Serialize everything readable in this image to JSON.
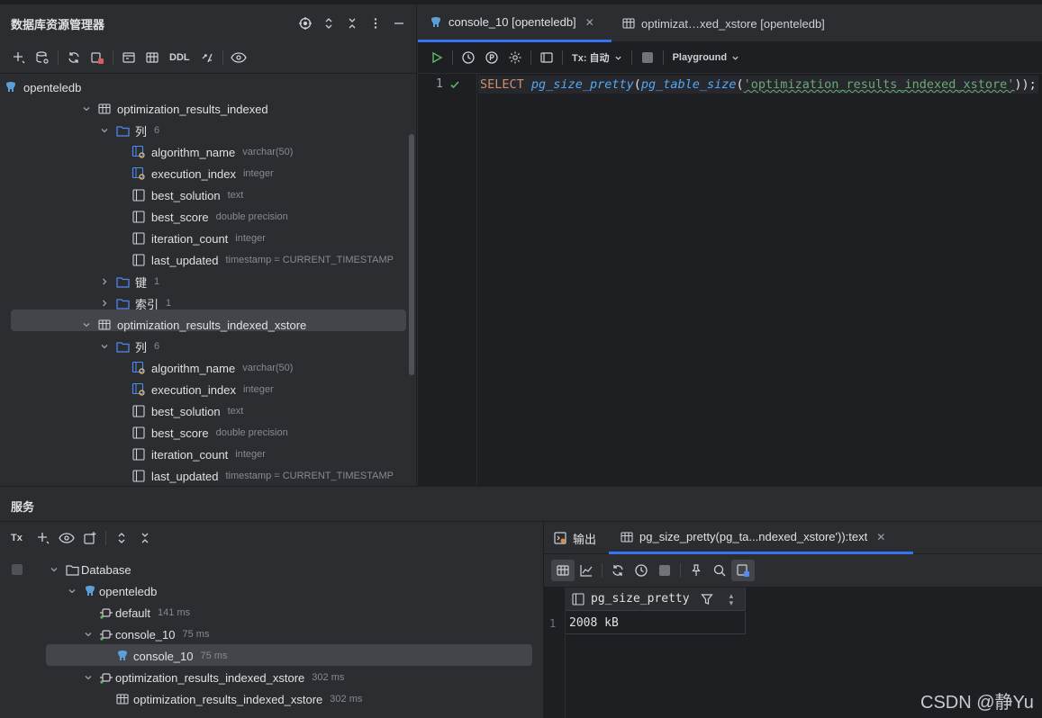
{
  "left_panel": {
    "title": "数据库资源管理器",
    "toolbar_ddl": "DDL",
    "tree": [
      {
        "label": "openteledb",
        "meta": ""
      },
      {
        "label": "optimization_results_indexed",
        "meta": ""
      },
      {
        "label": "列",
        "meta": "6"
      },
      {
        "label": "algorithm_name",
        "meta": "varchar(50)"
      },
      {
        "label": "execution_index",
        "meta": "integer"
      },
      {
        "label": "best_solution",
        "meta": "text"
      },
      {
        "label": "best_score",
        "meta": "double precision"
      },
      {
        "label": "iteration_count",
        "meta": "integer"
      },
      {
        "label": "last_updated",
        "meta": "timestamp = CURRENT_TIMESTAMP"
      },
      {
        "label": "键",
        "meta": "1"
      },
      {
        "label": "索引",
        "meta": "1"
      },
      {
        "label": "optimization_results_indexed_xstore",
        "meta": ""
      },
      {
        "label": "列",
        "meta": "6"
      },
      {
        "label": "algorithm_name",
        "meta": "varchar(50)"
      },
      {
        "label": "execution_index",
        "meta": "integer"
      },
      {
        "label": "best_solution",
        "meta": "text"
      },
      {
        "label": "best_score",
        "meta": "double precision"
      },
      {
        "label": "iteration_count",
        "meta": "integer"
      },
      {
        "label": "last_updated",
        "meta": "timestamp = CURRENT_TIMESTAMP"
      }
    ]
  },
  "editor": {
    "tabs": [
      {
        "label": "console_10 [openteledb]",
        "active": true
      },
      {
        "label": "optimizat…xed_xstore [openteledb]",
        "active": false
      }
    ],
    "tx_label": "Tx: 自动",
    "playground_label": "Playground",
    "line_number": "1",
    "code": {
      "kw": "SELECT",
      "fn1": "pg_size_pretty",
      "p1": "(",
      "fn2": "pg_table_size",
      "p2": "(",
      "str": "'optimization_results_indexed_xstore'",
      "tail": "));"
    }
  },
  "services": {
    "title": "服务",
    "tx_label": "Tx",
    "tree": [
      {
        "label": "Database",
        "meta": ""
      },
      {
        "label": "openteledb",
        "meta": ""
      },
      {
        "label": "default",
        "meta": "141 ms"
      },
      {
        "label": "console_10",
        "meta": "75 ms"
      },
      {
        "label": "console_10",
        "meta": "75 ms"
      },
      {
        "label": "optimization_results_indexed_xstore",
        "meta": "302 ms"
      },
      {
        "label": "optimization_results_indexed_xstore",
        "meta": "302 ms"
      }
    ]
  },
  "results": {
    "tabs": [
      {
        "label": "输出"
      },
      {
        "label": "pg_size_pretty(pg_ta...ndexed_xstore')):text"
      }
    ],
    "column_header": "pg_size_pretty",
    "rows": [
      {
        "num": "1",
        "value": "2008 kB"
      }
    ]
  },
  "watermark": "CSDN @静Yu",
  "colors": {
    "bg": "#2b2d30",
    "editor_bg": "#1e1f22",
    "accent": "#3574f0",
    "keyword": "#cf8e6d",
    "function": "#56a8f5",
    "string": "#6aab73",
    "run_green": "#5fb865"
  }
}
